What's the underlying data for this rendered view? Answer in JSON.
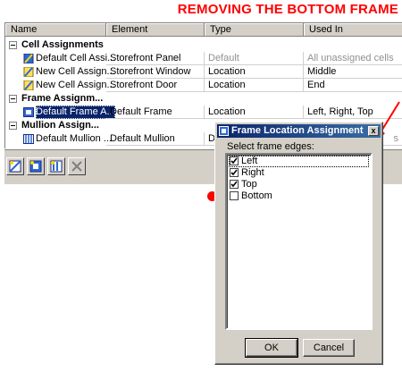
{
  "banner": "REMOVING THE BOTTOM FRAME",
  "columns": [
    "Name",
    "Element",
    "Type",
    "Used In"
  ],
  "groups": {
    "cell": {
      "label": "Cell Assignments"
    },
    "frame": {
      "label": "Frame Assignm..."
    },
    "mullion": {
      "label": "Mullion Assign..."
    }
  },
  "rows": {
    "r1": {
      "name": "Default Cell Assi...",
      "element": "Storefront Panel",
      "type": "Default",
      "used_in": "All unassigned cells"
    },
    "r2": {
      "name": "New Cell Assign...",
      "element": "Storefront Window",
      "type": "Location",
      "used_in": "Middle"
    },
    "r3": {
      "name": "New Cell Assign...",
      "element": "Storefront Door",
      "type": "Location",
      "used_in": "End"
    },
    "r4": {
      "name": "Default Frame A...",
      "element": "Default Frame",
      "type": "Location",
      "used_in": "Left, Right, Top"
    },
    "r5": {
      "name": "Default Mullion ...",
      "element": "Default Mullion",
      "type": "D",
      "used_in": "s"
    }
  },
  "dialog": {
    "title": "Frame Location Assignment",
    "close_label": "x",
    "prompt": "Select frame edges:",
    "edges": [
      {
        "label": "Left",
        "checked": true
      },
      {
        "label": "Right",
        "checked": true
      },
      {
        "label": "Top",
        "checked": true
      },
      {
        "label": "Bottom",
        "checked": false
      }
    ],
    "ok_label": "OK",
    "cancel_label": "Cancel"
  },
  "toolbar": {
    "icons": [
      "new-cell-assignment-icon",
      "new-frame-assignment-icon",
      "new-mullion-assignment-icon",
      "delete-icon"
    ]
  },
  "colors": {
    "banner": "#ff0000",
    "selection": "#0a246a",
    "dialog_title": "#0a246a",
    "face": "#d4d0c8"
  }
}
